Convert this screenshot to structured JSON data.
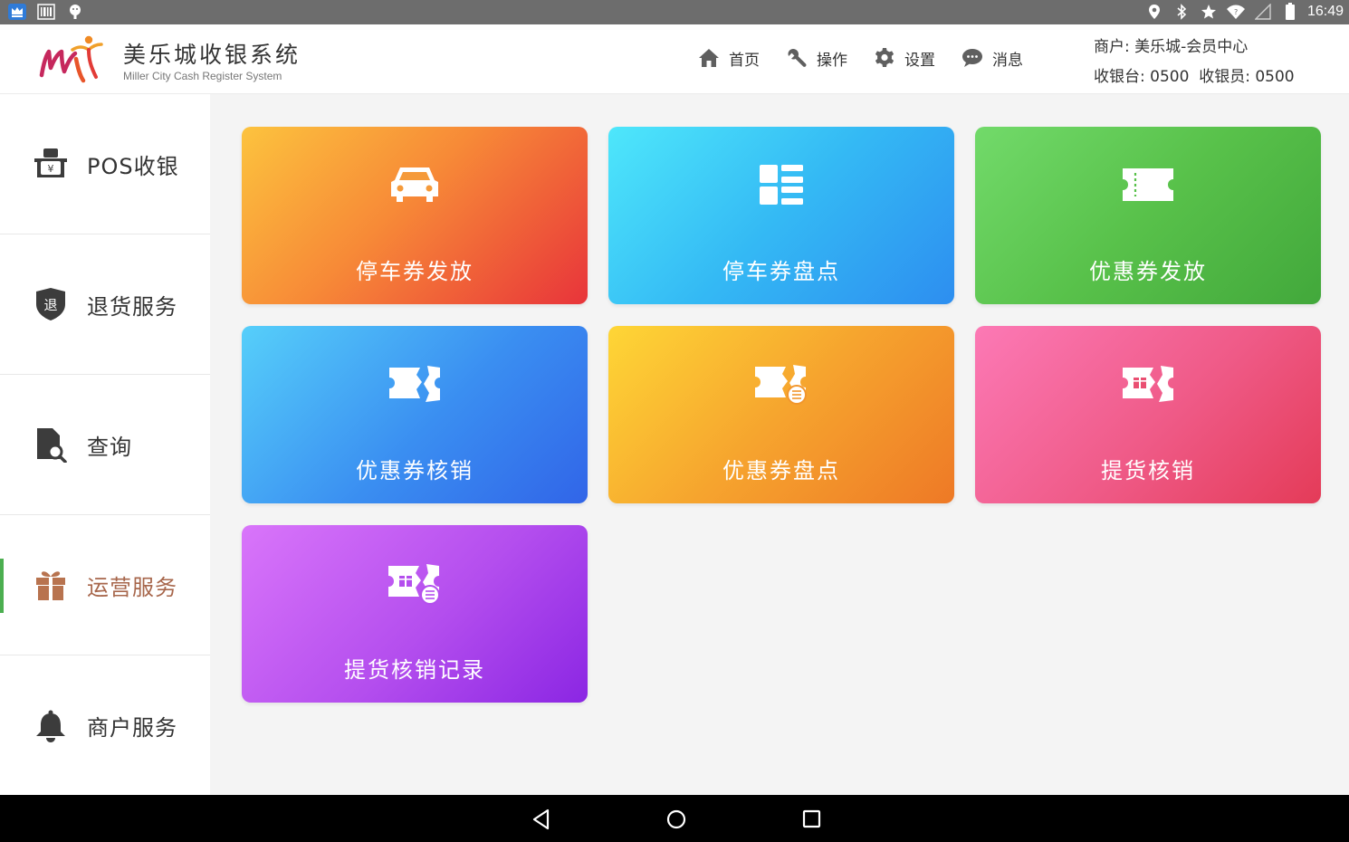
{
  "status_bar": {
    "time": "16:49",
    "left_icons": [
      "crown-app-icon",
      "barcode-icon",
      "android-icon"
    ],
    "right_icons": [
      "location-icon",
      "bluetooth-icon",
      "star-icon",
      "wifi-icon",
      "signal-icon",
      "battery-icon"
    ]
  },
  "header": {
    "brand_title": "美乐城收银系统",
    "brand_subtitle": "Miller City Cash Register System",
    "nav": [
      {
        "label": "首页",
        "icon": "home-icon"
      },
      {
        "label": "操作",
        "icon": "wrench-icon"
      },
      {
        "label": "设置",
        "icon": "gear-icon"
      },
      {
        "label": "消息",
        "icon": "chat-icon"
      }
    ],
    "merchant_line": "商户: 美乐城-会员中心",
    "register_line": "收银台: 0500  收银员: 0500"
  },
  "sidebar": {
    "items": [
      {
        "label": "POS收银",
        "icon": "cash-register-icon",
        "active": false
      },
      {
        "label": "退货服务",
        "icon": "return-shield-icon",
        "active": false
      },
      {
        "label": "查询",
        "icon": "document-search-icon",
        "active": false
      },
      {
        "label": "运营服务",
        "icon": "gift-icon",
        "active": true
      },
      {
        "label": "商户服务",
        "icon": "bell-icon",
        "active": false
      }
    ]
  },
  "tiles": [
    {
      "label": "停车券发放",
      "icon": "car-icon"
    },
    {
      "label": "停车券盘点",
      "icon": "list-icon"
    },
    {
      "label": "优惠券发放",
      "icon": "ticket-icon"
    },
    {
      "label": "优惠券核销",
      "icon": "torn-ticket-icon"
    },
    {
      "label": "优惠券盘点",
      "icon": "ticket-list-icon"
    },
    {
      "label": "提货核销",
      "icon": "gift-ticket-icon"
    },
    {
      "label": "提货核销记录",
      "icon": "gift-ticket-list-icon"
    }
  ],
  "colors": {
    "active_sidebar_text": "#a7664b",
    "active_indicator": "#4caf50",
    "status_bar": "#6d6d6d"
  },
  "nav_bar": [
    "back-icon",
    "home-circle-icon",
    "recents-icon"
  ]
}
